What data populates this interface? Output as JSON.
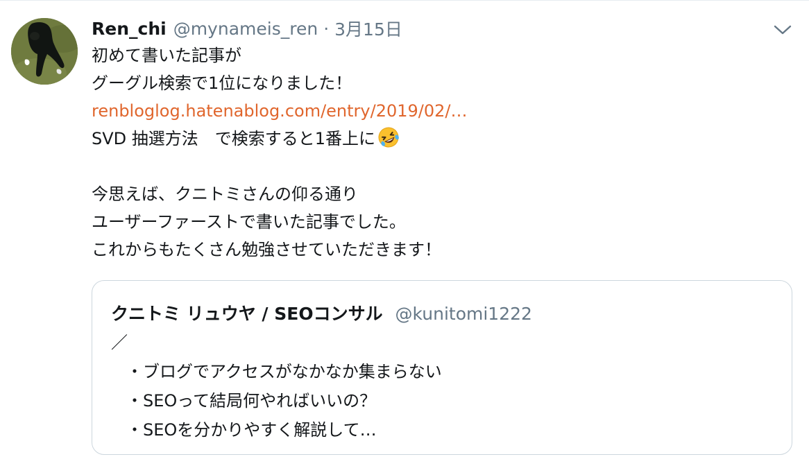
{
  "tweet": {
    "display_name": "Ren_chi",
    "handle": "@mynameis_ren",
    "separator": "·",
    "date": "3月15日",
    "menu_icon": "chevron-down-icon",
    "avatar_icon": "user-avatar-photo",
    "text": {
      "line1": "初めて書いた記事が",
      "line2": "グーグル検索で1位になりました！",
      "link": "renbloglog.hatenablog.com/entry/2019/02/…",
      "line4": "SVD 抽選方法　で検索すると1番上に",
      "emoji_icon": "rolling-on-floor-laughing-emoji",
      "line6": "今思えば、クニトミさんの仰る通り",
      "line7": "ユーザーファーストで書いた記事でした。",
      "line8": "これからもたくさん勉強させていただきます！"
    },
    "colors": {
      "link": "#e0662d",
      "secondary_text": "#657786",
      "border": "#ccd6dd"
    }
  },
  "quote": {
    "display_name": "クニトミ リュウヤ / SEOコンサル",
    "handle": "@kunitomi1222",
    "lines": [
      "／",
      "・ブログでアクセスがなかなか集まらない",
      "・SEOって結局何やればいいの？",
      "・SEOを分かりやすく解説して…"
    ]
  }
}
